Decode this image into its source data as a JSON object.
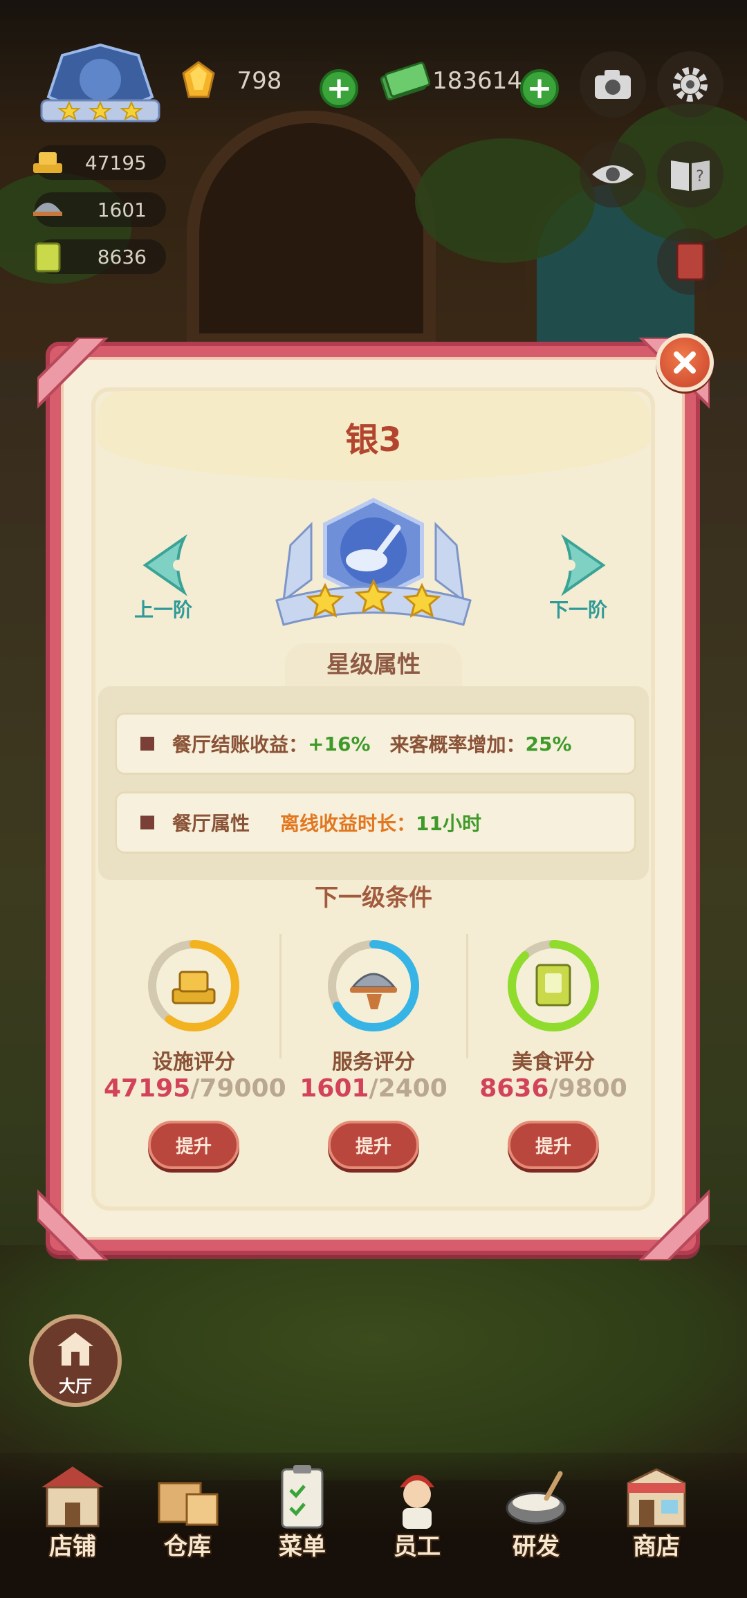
{
  "hud": {
    "gems": "798",
    "cash": "183614",
    "facility_stat": "47195",
    "service_stat": "1601",
    "food_stat": "8636"
  },
  "modal": {
    "title": "银3",
    "prev_label": "上一阶",
    "next_label": "下一阶",
    "section_title": "星级属性",
    "attributes": [
      {
        "label": "餐厅结账收益：",
        "value": "+16%",
        "label2": "来客概率增加：",
        "value2": "25%"
      },
      {
        "label": "餐厅属性",
        "label2": "离线收益时长：",
        "value2": "11小时"
      }
    ],
    "next_level_title": "下一级条件",
    "conditions": [
      {
        "name": "设施评分",
        "current": "47195",
        "required": "/79000",
        "progress": 0.6,
        "ring_color": "#f3b320",
        "button": "提升"
      },
      {
        "name": "服务评分",
        "current": "1601",
        "required": "/2400",
        "progress": 0.67,
        "ring_color": "#36b4e6",
        "button": "提升"
      },
      {
        "name": "美食评分",
        "current": "8636",
        "required": "/9800",
        "progress": 0.88,
        "ring_color": "#8fdc2c",
        "button": "提升"
      }
    ]
  },
  "hall_label": "大厅",
  "nav": [
    {
      "label": "店铺",
      "icon": "shop-icon"
    },
    {
      "label": "仓库",
      "icon": "warehouse-icon"
    },
    {
      "label": "菜单",
      "icon": "menu-clipboard-icon"
    },
    {
      "label": "员工",
      "icon": "staff-icon"
    },
    {
      "label": "研发",
      "icon": "research-pot-icon"
    },
    {
      "label": "商店",
      "icon": "store-icon"
    }
  ],
  "colors": {
    "modal_frame": "#d75c6c",
    "title": "#b3452e",
    "button": "#b9473e",
    "positive": "#3f9a2a",
    "highlight": "#e2771f"
  }
}
